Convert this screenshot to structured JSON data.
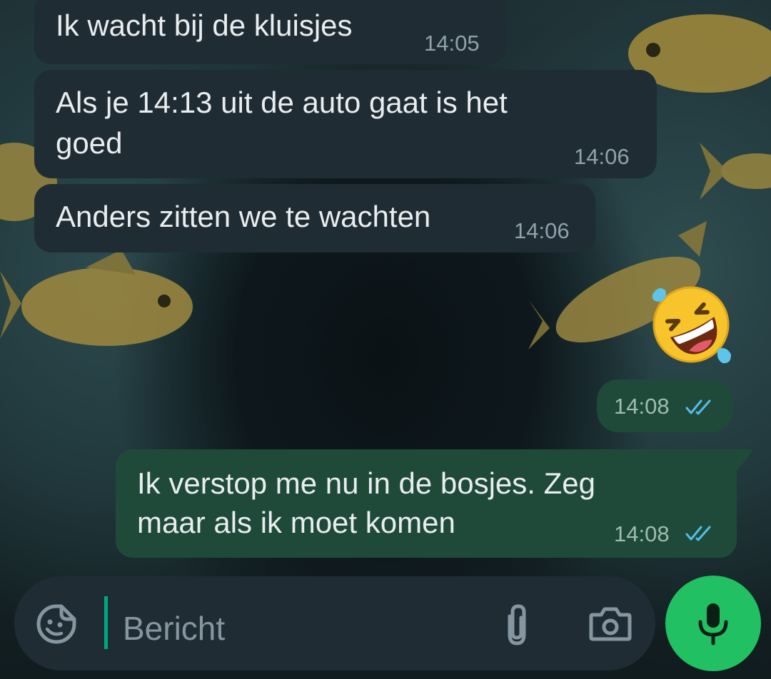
{
  "messages": [
    {
      "direction": "incoming",
      "text": "Ik wacht bij de kluisjes",
      "time": "14:05"
    },
    {
      "direction": "incoming",
      "text_line1": "Als je 14:13 uit de auto gaat is het",
      "text_line2": "goed",
      "time": "14:06"
    },
    {
      "direction": "incoming",
      "text": "Anders zitten we te wachten",
      "time": "14:06"
    },
    {
      "direction": "outgoing",
      "emoji": "rolling-on-the-floor-laughing",
      "time": "14:08",
      "status": "read"
    },
    {
      "direction": "outgoing",
      "text_line1": "Ik verstop me nu in de bosjes. Zeg",
      "text_line2": "maar als ik moet komen",
      "time": "14:08",
      "status": "read"
    }
  ],
  "composer": {
    "placeholder": "Bericht",
    "icons": [
      "sticker-icon",
      "paperclip-icon",
      "camera-icon"
    ],
    "send_icon": "microphone-icon"
  },
  "colors": {
    "incoming_bubble": "#1f2c34",
    "outgoing_bubble": "#1f4a3a",
    "accent": "#21c063",
    "read_ticks": "#53bdeb"
  }
}
